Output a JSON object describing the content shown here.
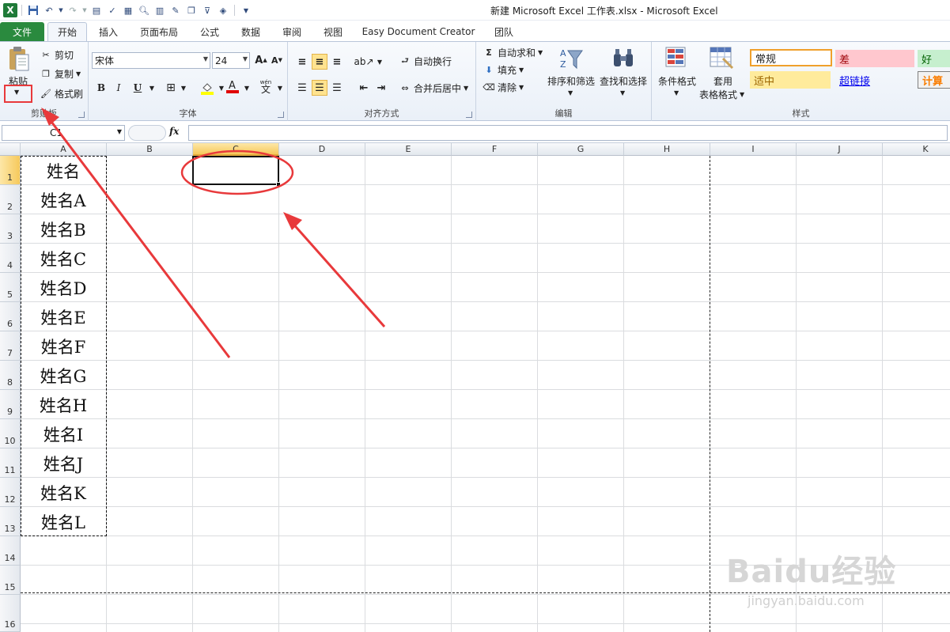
{
  "window": {
    "title": "新建 Microsoft Excel 工作表.xlsx  -  Microsoft Excel"
  },
  "tabs": [
    {
      "label": "文件"
    },
    {
      "label": "开始"
    },
    {
      "label": "插入"
    },
    {
      "label": "页面布局"
    },
    {
      "label": "公式"
    },
    {
      "label": "数据"
    },
    {
      "label": "审阅"
    },
    {
      "label": "视图"
    },
    {
      "label": "Easy Document Creator"
    },
    {
      "label": "团队"
    }
  ],
  "ribbon": {
    "clipboard": {
      "label": "剪贴板",
      "paste": "粘贴",
      "cut": "剪切",
      "copy": "复制",
      "format_painter": "格式刷"
    },
    "font": {
      "label": "字体",
      "font_name": "宋体",
      "font_size": "24"
    },
    "alignment": {
      "label": "对齐方式",
      "wrap_text": "自动换行",
      "merge_center": "合并后居中"
    },
    "editing": {
      "label": "编辑",
      "autosum": "自动求和",
      "fill": "填充",
      "clear": "清除",
      "sort_filter": "排序和筛选",
      "find_select": "查找和选择"
    },
    "styles": {
      "label": "样式",
      "conditional": "条件格式",
      "table_format_1": "套用",
      "table_format_2": "表格格式",
      "normal": "常规",
      "bad": "差",
      "good": "好",
      "neutral": "适中",
      "hyperlink": "超链接",
      "calc": "计算"
    }
  },
  "formula_bar": {
    "name_box": "C1",
    "fx": "fx",
    "content": ""
  },
  "grid": {
    "columns": [
      "A",
      "B",
      "C",
      "D",
      "E",
      "F",
      "G",
      "H",
      "I",
      "J",
      "K"
    ],
    "rows": [
      "1",
      "2",
      "3",
      "4",
      "5",
      "6",
      "7",
      "8",
      "9",
      "10",
      "11",
      "12",
      "13",
      "14",
      "15",
      "16"
    ],
    "column_a": [
      "姓名",
      "姓名A",
      "姓名B",
      "姓名C",
      "姓名D",
      "姓名E",
      "姓名F",
      "姓名G",
      "姓名H",
      "姓名I",
      "姓名J",
      "姓名K",
      "姓名L"
    ],
    "selected_cell": "C1"
  },
  "watermark": {
    "main": "Baidu经验",
    "sub": "jingyan.baidu.com"
  },
  "colors": {
    "file_tab": "#2a8a3e",
    "annotation": "#e8393b",
    "selected_header": "#f6c95b"
  }
}
